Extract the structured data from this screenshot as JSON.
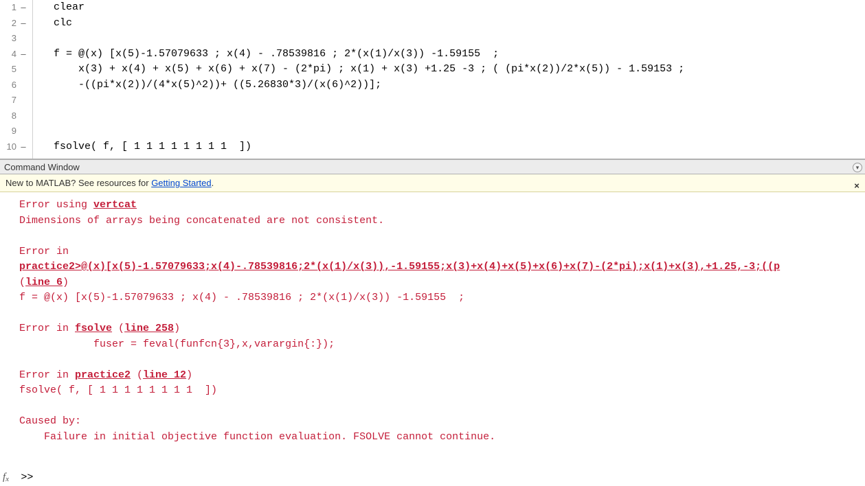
{
  "editor": {
    "lines": [
      {
        "num": "1",
        "dash": "–",
        "code": "clear"
      },
      {
        "num": "2",
        "dash": "–",
        "code": "clc"
      },
      {
        "num": "3",
        "dash": "",
        "code": ""
      },
      {
        "num": "4",
        "dash": "–",
        "code": "f = @(x) [x(5)-1.57079633 ; x(4) - .78539816 ; 2*(x(1)/x(3)) -1.59155  ;"
      },
      {
        "num": "5",
        "dash": "",
        "code": "    x(3) + x(4) + x(5) + x(6) + x(7) - (2*pi) ; x(1) + x(3) +1.25 -3 ; ( (pi*x(2))/2*x(5)) - 1.59153 ;"
      },
      {
        "num": "6",
        "dash": "",
        "code": "    -((pi*x(2))/(4*x(5)^2))+ ((5.26830*3)/(x(6)^2))];"
      },
      {
        "num": "7",
        "dash": "",
        "code": ""
      },
      {
        "num": "8",
        "dash": "",
        "code": ""
      },
      {
        "num": "9",
        "dash": "",
        "code": ""
      },
      {
        "num": "10",
        "dash": "–",
        "code": "fsolve( f, [ 1 1 1 1 1 1 1 1  ])"
      }
    ]
  },
  "command_window": {
    "title": "Command Window",
    "tip_prefix": "New to MATLAB? See resources for ",
    "tip_link": "Getting Started",
    "tip_suffix": ".",
    "error": {
      "l1a": "Error using ",
      "l1b": "vertcat",
      "l2": "Dimensions of arrays being concatenated are not consistent.",
      "l3": "",
      "l4": "Error in",
      "l5": "practice2>@(x)[x(5)-1.57079633;x(4)-.78539816;2*(x(1)/x(3)),-1.59155;x(3)+x(4)+x(5)+x(6)+x(7)-(2*pi);x(1)+x(3),+1.25,-3;((p",
      "l6a": "(",
      "l6b": "line 6",
      "l6c": ")",
      "l7": "f = @(x) [x(5)-1.57079633 ; x(4) - .78539816 ; 2*(x(1)/x(3)) -1.59155  ;",
      "l8": "",
      "l9a": "Error in ",
      "l9b": "fsolve",
      "l9c": " (",
      "l9d": "line 258",
      "l9e": ")",
      "l10": "            fuser = feval(funfcn{3},x,varargin{:});",
      "l11": "",
      "l12a": "Error in ",
      "l12b": "practice2",
      "l12c": " (",
      "l12d": "line 12",
      "l12e": ")",
      "l13": "fsolve( f, [ 1 1 1 1 1 1 1 1  ])",
      "l14": "",
      "l15": "Caused by:",
      "l16": "    Failure in initial objective function evaluation. FSOLVE cannot continue."
    },
    "prompt": ">> "
  }
}
